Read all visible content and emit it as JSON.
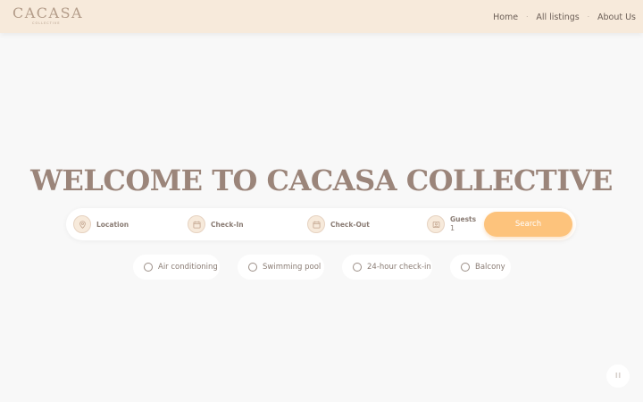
{
  "header": {
    "logo_main": "CACASA",
    "logo_sub": "COLLECTIVE",
    "nav": [
      "Home",
      "All listings",
      "About Us"
    ],
    "nav_separator": "·"
  },
  "hero": {
    "title": "WELCOME TO CACASA COLLECTIVE"
  },
  "search": {
    "location_label": "Location",
    "checkin_label": "Check-In",
    "checkout_label": "Check-Out",
    "guests_label": "Guests",
    "guests_value": "1",
    "button_label": "Search",
    "icons": [
      "location-pin-icon",
      "calendar-icon",
      "calendar-icon",
      "guests-icon"
    ]
  },
  "filters": [
    {
      "label": "Air conditioning",
      "checked": false
    },
    {
      "label": "Swimming pool",
      "checked": false
    },
    {
      "label": "24-hour check-in",
      "checked": false
    },
    {
      "label": "Balcony",
      "checked": false
    }
  ],
  "colors": {
    "header_bg": "#f7eadb",
    "page_bg": "#f8f8f8",
    "title": "#9b857a",
    "search_button": "#fdc37c",
    "nav_text": "#6c5f57"
  }
}
